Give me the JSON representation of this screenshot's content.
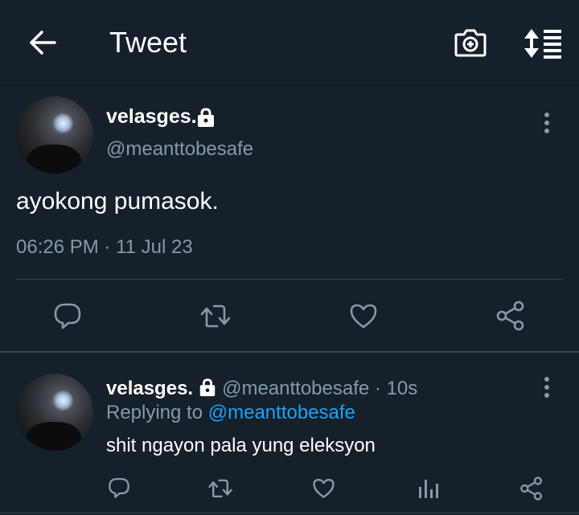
{
  "header": {
    "title": "Tweet",
    "back_icon": "arrow-left-icon",
    "camera_icon": "camera-plus-icon",
    "sort_icon": "sort-list-icon"
  },
  "main_tweet": {
    "name": "velasges.",
    "handle": "@meanttobesafe",
    "text": "ayokong pumasok.",
    "time": "06:26 PM",
    "separator": "·",
    "date": "11 Jul 23",
    "actions": [
      "reply-icon",
      "retweet-icon",
      "like-icon",
      "share-icon"
    ]
  },
  "reply_tweet": {
    "name": "velasges.",
    "handle": "@meanttobesafe",
    "separator": "·",
    "time_ago": "10s",
    "replying_prefix": "Replying to",
    "replying_to": "@meanttobesafe",
    "text": "shit ngayon pala yung eleksyon",
    "actions": [
      "reply-icon",
      "retweet-icon",
      "like-icon",
      "analytics-icon",
      "share-icon"
    ]
  },
  "colors": {
    "background": "#15202b",
    "divider": "#38444d",
    "secondary_text": "#8899a6",
    "link": "#1da1f2",
    "icon": "#8899a6"
  }
}
